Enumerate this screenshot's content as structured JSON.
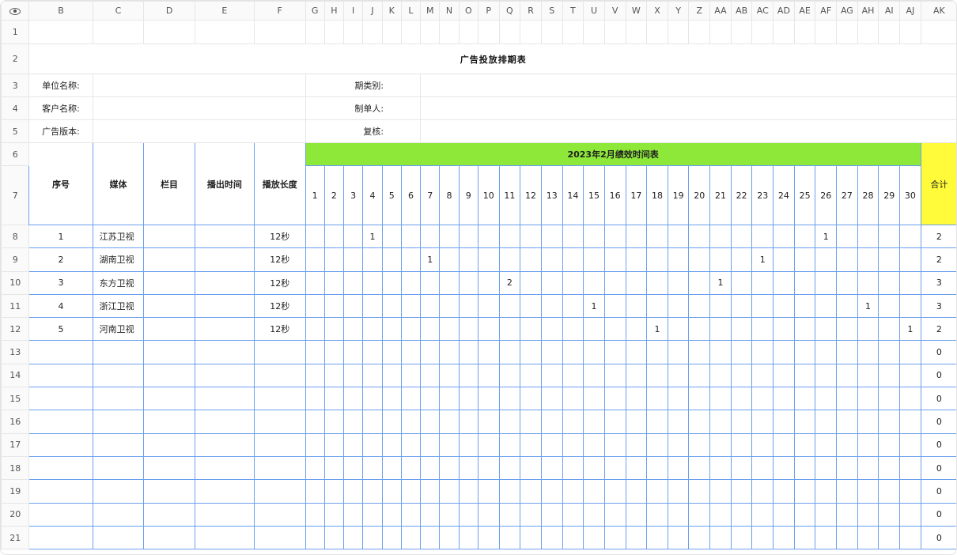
{
  "columns": [
    "B",
    "C",
    "D",
    "E",
    "F",
    "G",
    "H",
    "I",
    "J",
    "K",
    "L",
    "M",
    "N",
    "O",
    "P",
    "Q",
    "R",
    "S",
    "T",
    "U",
    "V",
    "W",
    "X",
    "Y",
    "Z",
    "AA",
    "AB",
    "AC",
    "AD",
    "AE",
    "AF",
    "AG",
    "AH",
    "AI",
    "AJ",
    "AK"
  ],
  "title": "广告投放排期表",
  "labels": {
    "unit_name": "单位名称:",
    "client_name": "客户名称:",
    "ad_version": "广告版本:",
    "period_type": "期类别:",
    "maker": "制单人:",
    "review": "复核:"
  },
  "headers": {
    "index": "序号",
    "media": "媒体",
    "column": "栏目",
    "air_time": "播出时间",
    "duration": "播放长度",
    "schedule": "2023年2月绩效时间表",
    "total": "合计"
  },
  "days": [
    "1",
    "2",
    "3",
    "4",
    "5",
    "6",
    "7",
    "8",
    "9",
    "10",
    "11",
    "12",
    "13",
    "14",
    "15",
    "16",
    "17",
    "18",
    "19",
    "20",
    "21",
    "22",
    "23",
    "24",
    "25",
    "26",
    "27",
    "28",
    "29",
    "30"
  ],
  "rows": [
    {
      "idx": "1",
      "media": "江苏卫视",
      "dur": "12秒",
      "marks": {
        "4": "1",
        "26": "1"
      },
      "total": "2"
    },
    {
      "idx": "2",
      "media": "湖南卫视",
      "dur": "12秒",
      "marks": {
        "7": "1",
        "23": "1"
      },
      "total": "2"
    },
    {
      "idx": "3",
      "media": "东方卫视",
      "dur": "12秒",
      "marks": {
        "11": "2",
        "21": "1"
      },
      "total": "3"
    },
    {
      "idx": "4",
      "media": "浙江卫视",
      "dur": "12秒",
      "marks": {
        "15": "1",
        "28": "1"
      },
      "total": "3"
    },
    {
      "idx": "5",
      "media": "河南卫视",
      "dur": "12秒",
      "marks": {
        "18": "1",
        "30": "1"
      },
      "total": "2"
    },
    {
      "idx": "",
      "media": "",
      "dur": "",
      "marks": {},
      "total": "0"
    },
    {
      "idx": "",
      "media": "",
      "dur": "",
      "marks": {},
      "total": "0"
    },
    {
      "idx": "",
      "media": "",
      "dur": "",
      "marks": {},
      "total": "0"
    },
    {
      "idx": "",
      "media": "",
      "dur": "",
      "marks": {},
      "total": "0"
    },
    {
      "idx": "",
      "media": "",
      "dur": "",
      "marks": {},
      "total": "0"
    },
    {
      "idx": "",
      "media": "",
      "dur": "",
      "marks": {},
      "total": "0"
    },
    {
      "idx": "",
      "media": "",
      "dur": "",
      "marks": {},
      "total": "0"
    },
    {
      "idx": "",
      "media": "",
      "dur": "",
      "marks": {},
      "total": "0"
    },
    {
      "idx": "",
      "media": "",
      "dur": "",
      "marks": {},
      "total": "0"
    }
  ],
  "row_numbers": [
    "1",
    "2",
    "3",
    "4",
    "5",
    "6",
    "7",
    "8",
    "9",
    "10",
    "11",
    "12",
    "13",
    "14",
    "15",
    "16",
    "17",
    "18",
    "19",
    "20",
    "21"
  ],
  "colors": {
    "header_green": "#8ee83a",
    "total_yellow": "#fffb3a",
    "grid_blue": "#6aa0ee"
  }
}
